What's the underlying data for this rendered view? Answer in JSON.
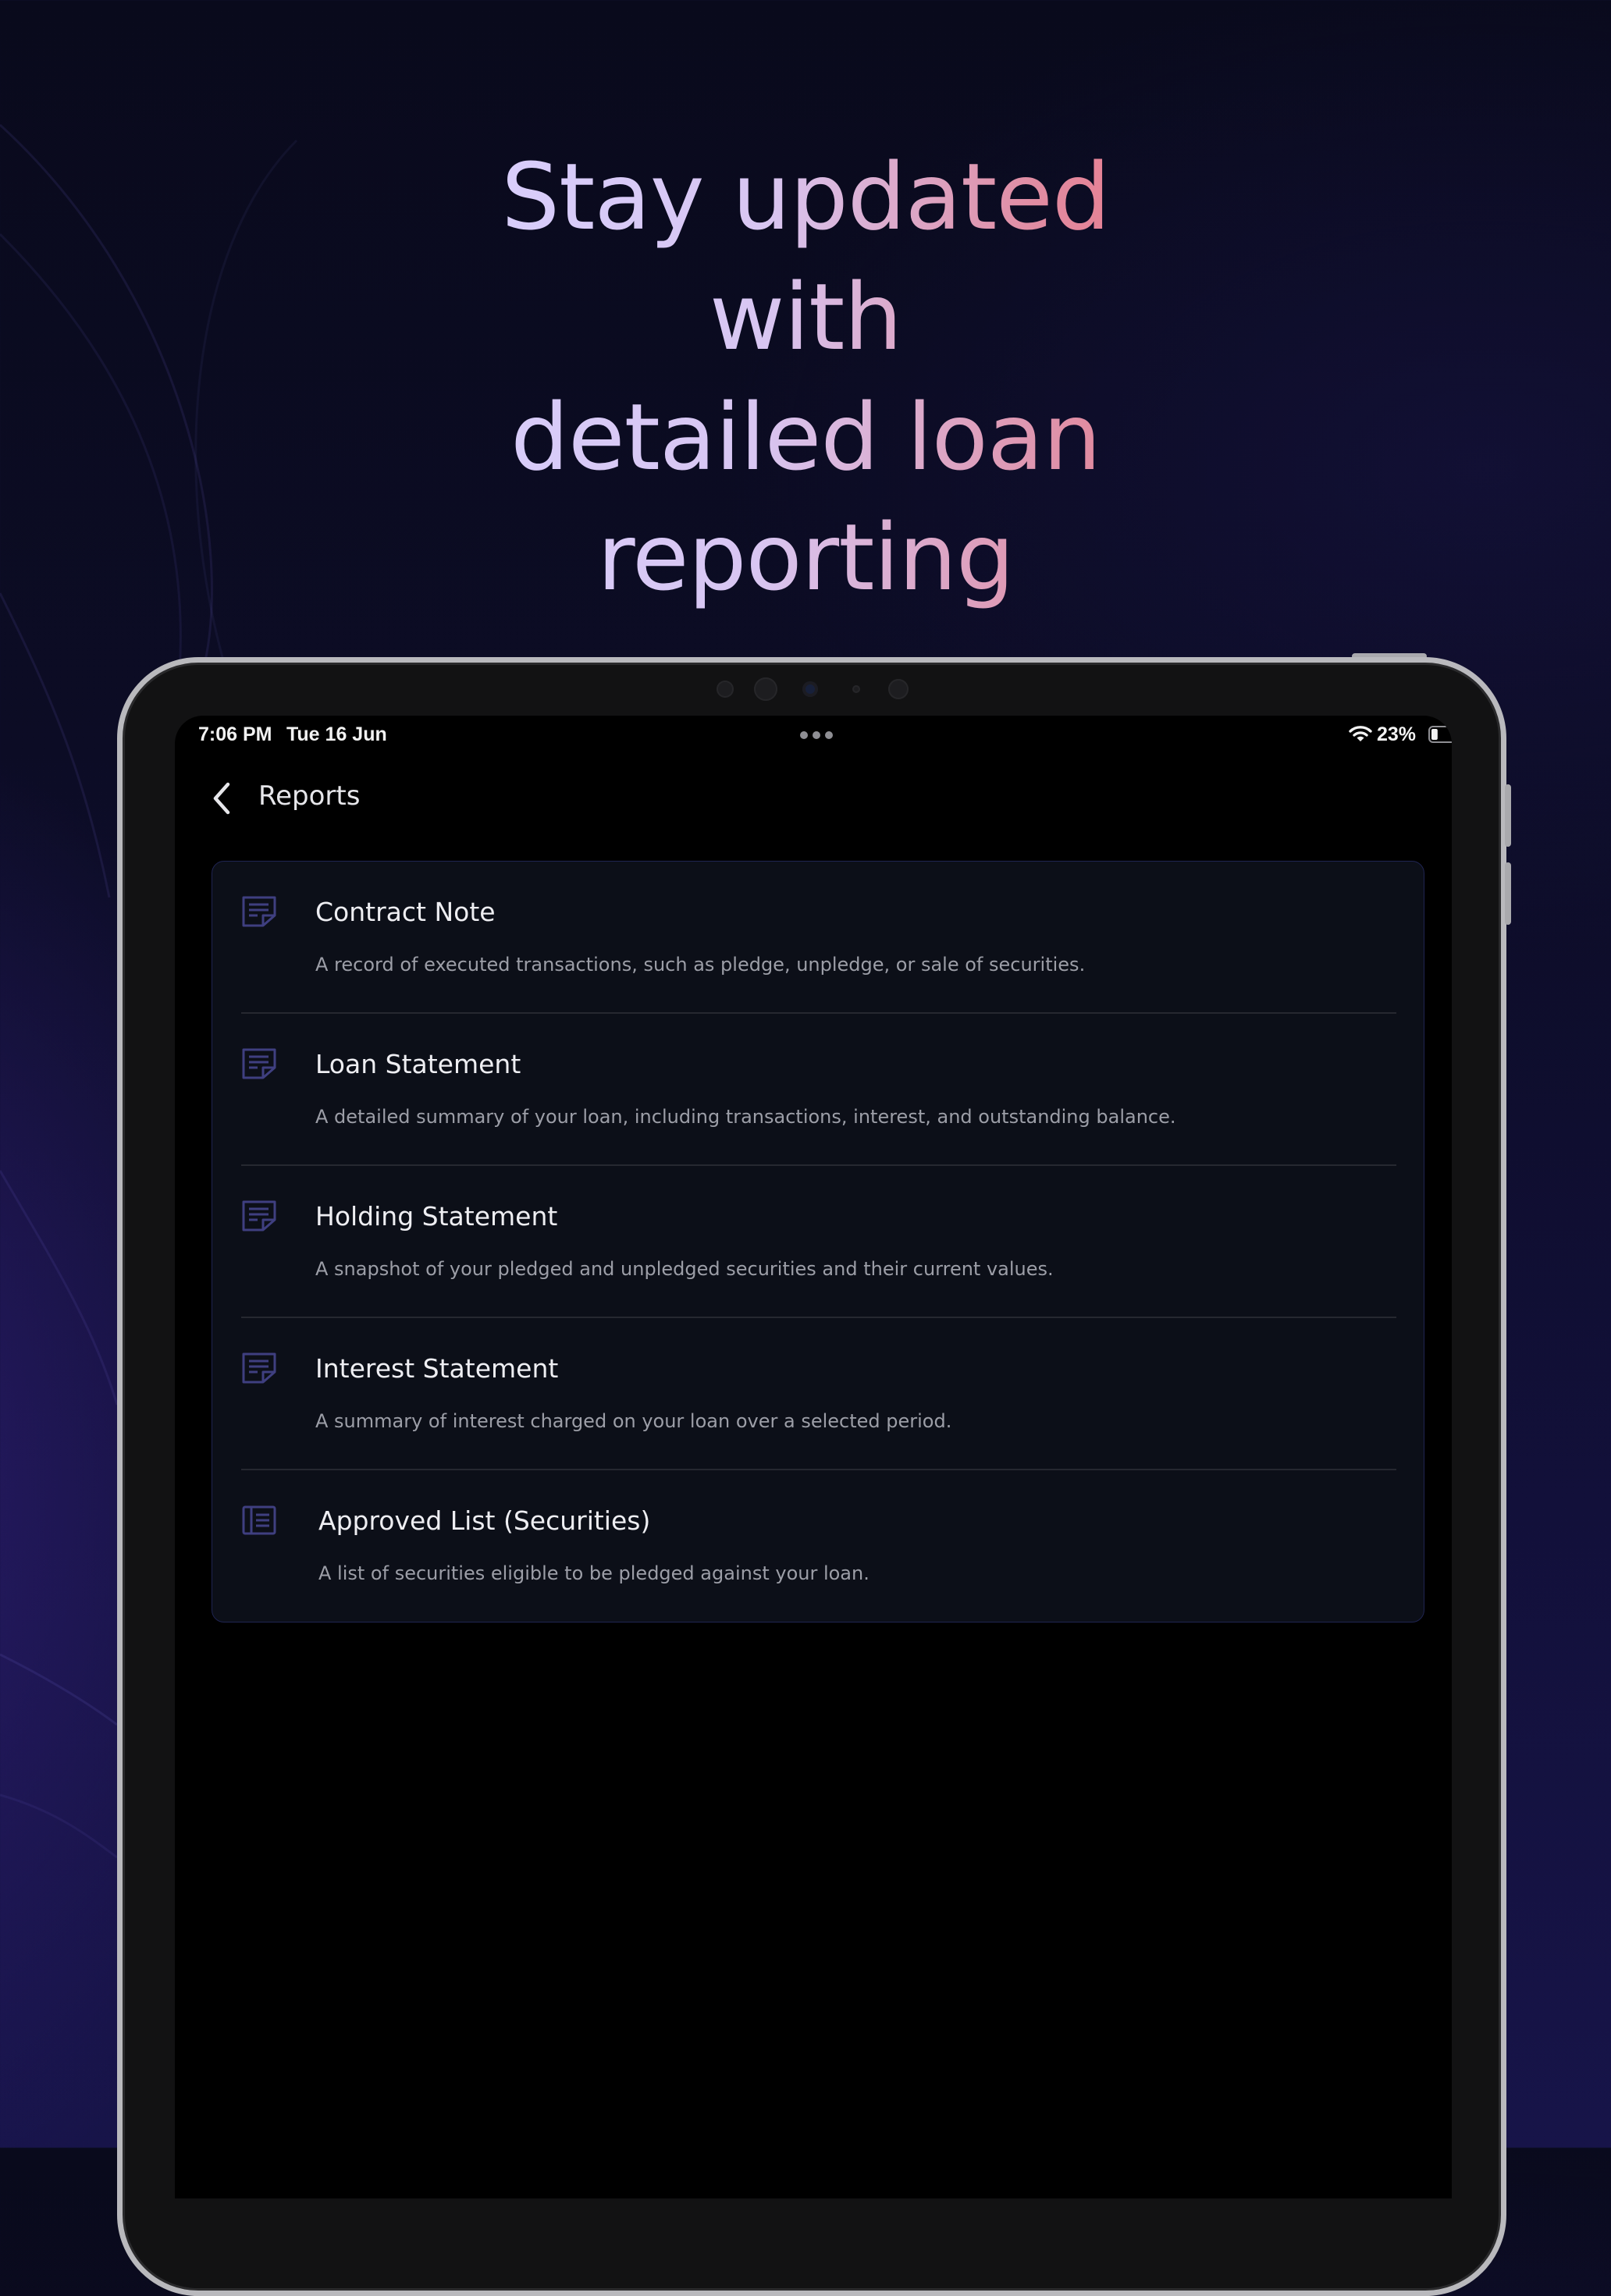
{
  "headline": {
    "line1": "Stay updated with",
    "line2": "detailed loan reporting"
  },
  "status_bar": {
    "time": "7:06 PM",
    "date": "Tue 16 Jun",
    "battery": "23%",
    "battery_level": 0.23,
    "wifi_icon": "wifi-icon",
    "battery_icon": "battery-icon"
  },
  "nav": {
    "back_icon": "chevron-left-icon",
    "title": "Reports"
  },
  "reports": [
    {
      "title": "Contract Note",
      "description": "A record of executed transactions, such as pledge, unpledge, or sale of securities.",
      "icon": "document-icon"
    },
    {
      "title": "Loan Statement",
      "description": "A detailed summary of your loan, including transactions, interest, and outstanding balance.",
      "icon": "document-icon"
    },
    {
      "title": "Holding Statement",
      "description": "A snapshot of your pledged and unpledged securities and their current values.",
      "icon": "document-icon"
    },
    {
      "title": "Interest Statement",
      "description": "A summary of interest charged on your loan over a selected period.",
      "icon": "document-icon"
    },
    {
      "title": "Approved List (Securities)",
      "description": "A list of securities eligible to be pledged against your loan.",
      "icon": "list-icon"
    }
  ],
  "colors": {
    "background": "#0b0b22",
    "headline_start": "#d9d1ff",
    "headline_end": "#ee7585",
    "card_background": "#0c0f18",
    "card_border": "#1f2452",
    "icon_accent": "#3f3f80",
    "screen_background": "#000000"
  }
}
